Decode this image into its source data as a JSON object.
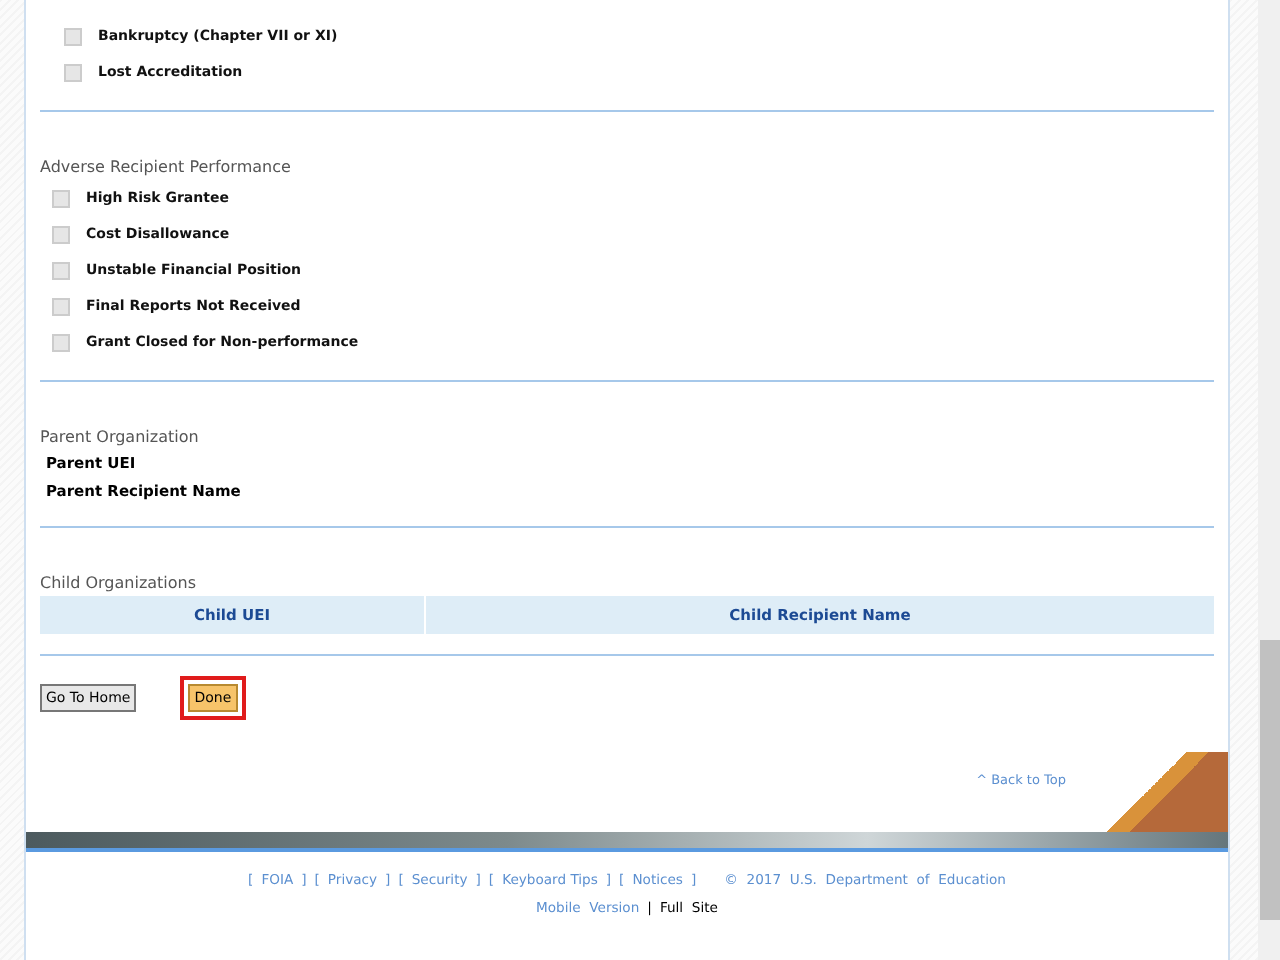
{
  "sections": [
    {
      "items": [
        {
          "label": "Bankruptcy (Chapter VII or XI)",
          "checked": false
        },
        {
          "label": "Lost Accreditation",
          "checked": false
        }
      ]
    },
    {
      "title": "Adverse Recipient Performance",
      "items": [
        {
          "label": "High Risk Grantee",
          "checked": false
        },
        {
          "label": "Cost Disallowance",
          "checked": false
        },
        {
          "label": "Unstable Financial Position",
          "checked": false
        },
        {
          "label": "Final Reports Not Received",
          "checked": false
        },
        {
          "label": "Grant Closed for Non-performance",
          "checked": false
        }
      ]
    }
  ],
  "parent_organization": {
    "title": "Parent Organization",
    "fields": [
      "Parent UEI",
      "Parent Recipient Name"
    ]
  },
  "child_organizations": {
    "title": "Child Organizations",
    "columns": [
      "Child UEI",
      "Child Recipient Name"
    ]
  },
  "buttons": [
    {
      "label": "Go To Home",
      "kind": "plain",
      "focused": false
    },
    {
      "label": "Done",
      "kind": "primary",
      "focused": true
    }
  ],
  "back_to_top": "^ Back to Top",
  "footer": {
    "bracket_open": "[",
    "bracket_close": "]",
    "links": [
      "FOIA",
      "Privacy",
      "Security",
      "Keyboard Tips",
      "Notices"
    ],
    "copyright": "©  2017  U.S.  Department  of  Education",
    "mobile": "Mobile  Version",
    "separator": "|",
    "full_site": "Full  Site"
  }
}
